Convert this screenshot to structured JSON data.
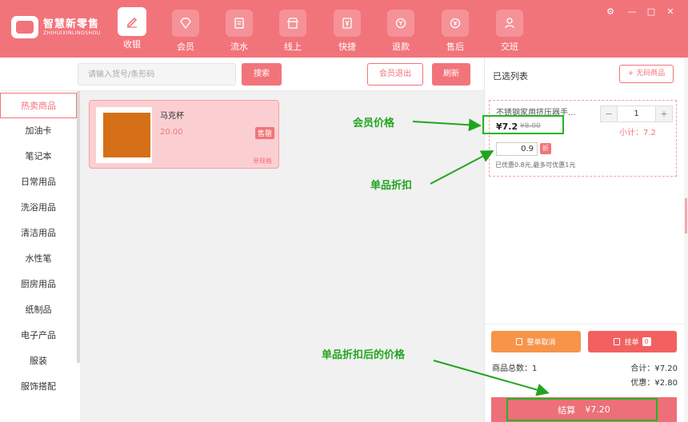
{
  "app": {
    "logo_cn": "智慧新零售",
    "logo_en": "ZHIHUIXINLINGSHOU"
  },
  "nav": [
    {
      "label": "收银",
      "icon": "pencil-icon"
    },
    {
      "label": "会员",
      "icon": "diamond-icon"
    },
    {
      "label": "流水",
      "icon": "receipt-icon"
    },
    {
      "label": "线上",
      "icon": "store-icon"
    },
    {
      "label": "快捷",
      "icon": "yen-fast-icon"
    },
    {
      "label": "退款",
      "icon": "refund-icon"
    },
    {
      "label": "售后",
      "icon": "after-sale-icon"
    },
    {
      "label": "交班",
      "icon": "shift-icon"
    }
  ],
  "window": {
    "settings": "⚙",
    "minimize": "—",
    "maximize": "□",
    "close": "✕"
  },
  "toolbar": {
    "search_placeholder": "请输入货号/条形码",
    "search_label": "搜索",
    "member_logout_label": "会员退出",
    "refresh_label": "刷新"
  },
  "sidebar": {
    "items": [
      "热卖商品",
      "加油卡",
      "笔记本",
      "日常用品",
      "洗浴用品",
      "清洁用品",
      "水性笔",
      "厨房用品",
      "纸制品",
      "电子产品",
      "服装",
      "服饰搭配"
    ]
  },
  "product": {
    "name": "马克杯",
    "price": "20.00",
    "badge": "售罄",
    "spec": "单规格",
    "image_color": "#d57018"
  },
  "cart": {
    "title": "已选列表",
    "no_code_label": "+ 无码商品",
    "item": {
      "name": "不锈钢家用挤压器手...",
      "price": "¥7.2",
      "original_price": "¥8.00",
      "quantity": "1",
      "minus": "−",
      "plus": "+",
      "subtotal": "小计：7.2",
      "discount_value": "0.9",
      "discount_tag": "折",
      "discount_note": "已优惠0.8元,最多可优惠1元"
    },
    "cancel_label": "整单取消",
    "hold_label": "挂单",
    "hold_count": "0",
    "total_count": "商品总数：1",
    "total": "合计：¥7.20",
    "discount": "优惠：¥2.80",
    "checkout_label": "结算",
    "checkout_amount": "¥7.20"
  },
  "annotations": {
    "member_price": "会员价格",
    "item_discount": "单品折扣",
    "discounted_price": "单品折扣后的价格",
    "color": "#22a51e"
  },
  "colors": {
    "brand": "#f2747b",
    "orange": "#f7944a",
    "red": "#f26160"
  }
}
